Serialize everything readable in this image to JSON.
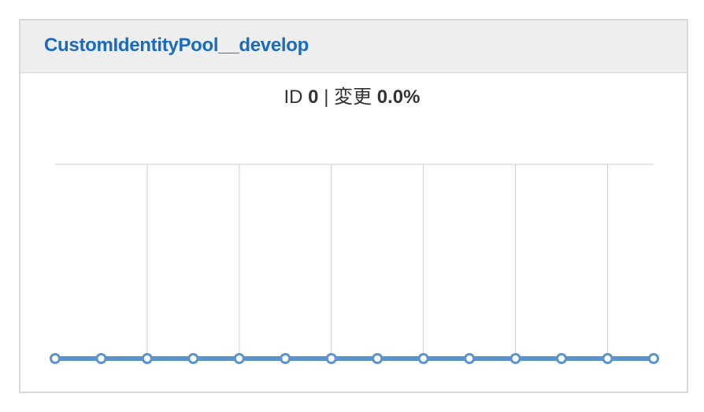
{
  "panel": {
    "title": "CustomIdentityPool__develop"
  },
  "summary": {
    "id_label": "ID",
    "id_value": "0",
    "separator": "|",
    "change_label": "変更",
    "change_value": "0.0%"
  },
  "colors": {
    "title": "#1a6bbf",
    "series": "#5b93cc",
    "grid": "#cccccc"
  },
  "chart_data": {
    "type": "line",
    "x": [
      1,
      2,
      3,
      4,
      5,
      6,
      7,
      8,
      9,
      10,
      11,
      12,
      13,
      14
    ],
    "series": [
      {
        "values": [
          0,
          0,
          0,
          0,
          0,
          0,
          0,
          0,
          0,
          0,
          0,
          0,
          0,
          0
        ]
      }
    ],
    "ylim": [
      0,
      1
    ],
    "grid": "vertical lines every other point, top border line",
    "title": "",
    "xlabel": "",
    "ylabel": ""
  }
}
